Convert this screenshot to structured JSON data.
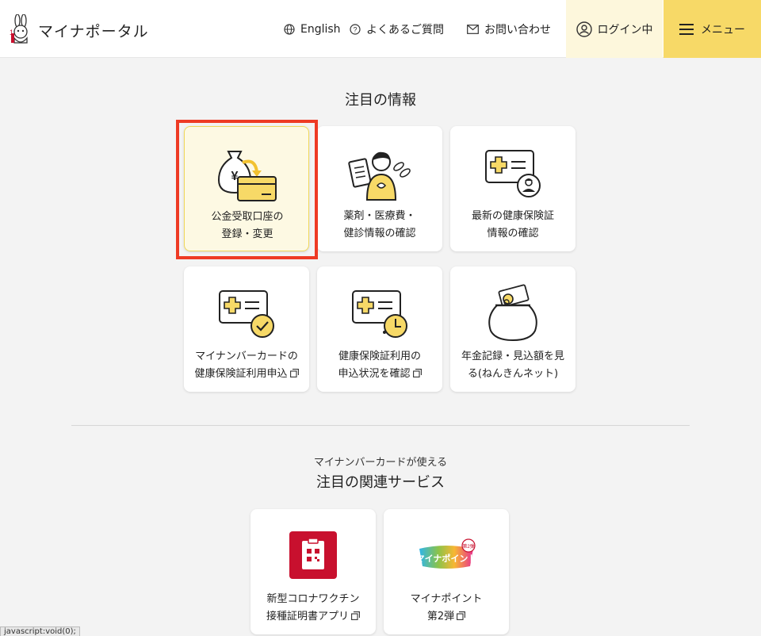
{
  "header": {
    "logo_text": "マイナポータル",
    "english_label": "English",
    "faq_label": "よくあるご質問",
    "contact_label": "お問い合わせ",
    "login_label": "ログイン中",
    "menu_label": "メニュー"
  },
  "featured": {
    "title": "注目の情報",
    "cards": [
      {
        "line1": "公金受取口座の",
        "line2": "登録・変更"
      },
      {
        "line1": "薬剤・医療費・",
        "line2": "健診情報の確認"
      },
      {
        "line1": "最新の健康保険証",
        "line2": "情報の確認"
      },
      {
        "line1": "マイナンバーカードの",
        "line2": "健康保険証利用申込"
      },
      {
        "line1": "健康保険証利用の",
        "line2": "申込状況を確認"
      },
      {
        "line1": "年金記録・見込額を見",
        "line2": "る(ねんきんネット)"
      }
    ]
  },
  "related": {
    "subtitle": "マイナンバーカードが使える",
    "title": "注目の関連サービス",
    "cards": [
      {
        "line1": "新型コロナワクチン",
        "line2": "接種証明書アプリ"
      },
      {
        "line1": "マイナポイント",
        "line2": "第2弾"
      }
    ],
    "mynapoint_logo_text": "マイナポイント",
    "mynapoint_badge": "第2弾"
  },
  "status_bar": "javascript:void(0);",
  "colors": {
    "accent_yellow": "#f7d967",
    "login_bg": "#fdf7dc",
    "highlight_frame": "#ee3a24",
    "vaccine_red": "#c8102e"
  }
}
